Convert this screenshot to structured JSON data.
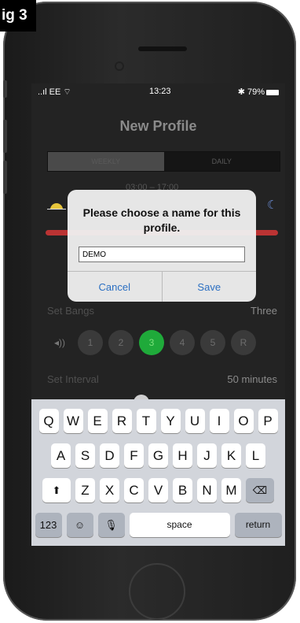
{
  "figure_label": "ig 3",
  "status": {
    "carrier": "..ıl EE ⌔",
    "time": "13:23",
    "battery": "✱ 79%"
  },
  "screen_title": "New Profile",
  "segment": {
    "weekly": "WEEKLY",
    "daily": "DAILY"
  },
  "time_range": "03:00 – 17:00",
  "set_bangs": {
    "label": "Set Bangs",
    "value": "Three"
  },
  "bang_options": [
    "1",
    "2",
    "3",
    "4",
    "5",
    "R"
  ],
  "set_interval": {
    "label": "Set Interval",
    "value": "50 minutes"
  },
  "alert": {
    "message": "Please choose a name for this profile.",
    "input_value": "DEMO",
    "cancel_label": "Cancel",
    "save_label": "Save"
  },
  "keyboard": {
    "row1": [
      "Q",
      "W",
      "E",
      "R",
      "T",
      "Y",
      "U",
      "I",
      "O",
      "P"
    ],
    "row2": [
      "A",
      "S",
      "D",
      "F",
      "G",
      "H",
      "J",
      "K",
      "L"
    ],
    "row3": [
      "Z",
      "X",
      "C",
      "V",
      "B",
      "N",
      "M"
    ],
    "numbers_label": "123",
    "space_label": "space",
    "return_label": "return"
  }
}
